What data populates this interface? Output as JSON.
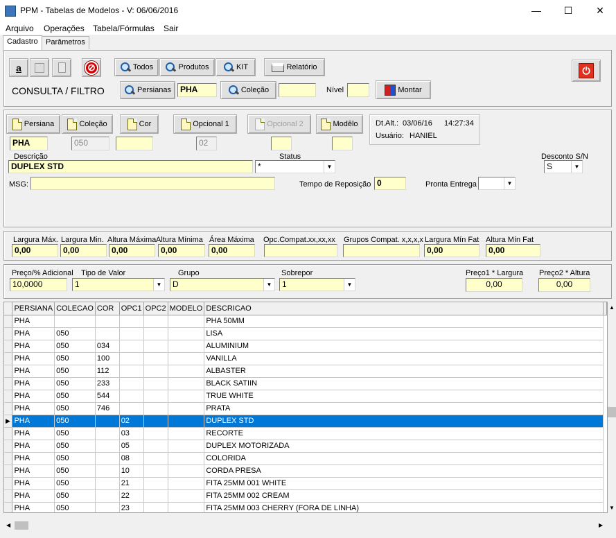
{
  "window": {
    "title": "PPM - Tabelas de Modelos - V: 06/06/2016",
    "minimize": "—",
    "maximize": "☐",
    "close": "✕"
  },
  "menu": [
    "Arquivo",
    "Operações",
    "Tabela/Fórmulas",
    "Sair"
  ],
  "tabs": [
    "Cadastro",
    "Parâmetros"
  ],
  "toolbar": {
    "todos": "Todos",
    "produtos": "Produtos",
    "kit": "KIT",
    "relatorio": "Relatório",
    "persianas": "Persianas",
    "colecao": "Coleção",
    "montar": "Montar",
    "consulta_label": "CONSULTA / FILTRO",
    "nivel_label": "Nível",
    "persiana_filter": "PHA",
    "colecao_filter": "",
    "nivel_value": ""
  },
  "record": {
    "persiana_btn": "Persiana",
    "colecao_btn": "Coleção",
    "cor_btn": "Cor",
    "opc1_btn": "Opcional 1",
    "opc2_btn": "Opcional 2",
    "modelo_btn": "Modêlo",
    "persiana": "PHA",
    "colecao": "050",
    "cor": "",
    "opc1": "02",
    "opc2": "",
    "modelo": "",
    "dt_alt_label": "Dt.Alt.:",
    "dt_alt_date": "03/06/16",
    "dt_alt_time": "14:27:34",
    "usuario_label": "Usuário:",
    "usuario": "HANIEL",
    "descricao_label": "Descrição",
    "descricao": "DUPLEX STD",
    "status_label": "Status",
    "status": "*",
    "desconto_label": "Desconto S/N",
    "desconto": "S",
    "msg_label": "MSG:",
    "msg": "",
    "tempo_label": "Tempo de Reposição",
    "tempo": "0",
    "pronta_label": "Pronta Entrega",
    "pronta": ""
  },
  "dims": {
    "larg_max_label": "Largura Máx.",
    "larg_max": "0,00",
    "larg_min_label": "Largura Min.",
    "larg_min": "0,00",
    "alt_max_label": "Altura Máxima",
    "alt_max": "0,00",
    "alt_min_label": "Altura Mínima",
    "alt_min": "0,00",
    "area_label": "Área Máxima",
    "area": "0,00",
    "opc_compat_label": "Opc.Compat.xx,xx,xx",
    "opc_compat": "",
    "grupos_label": "Grupos Compat. x,x,x,x",
    "grupos": "",
    "larg_fat_label": "Largura Mín Fat",
    "larg_fat": "0,00",
    "alt_fat_label": "Altura Mín Fat",
    "alt_fat": "0,00"
  },
  "price": {
    "preco_label": "Preço/% Adicional",
    "preco": "10,0000",
    "tipo_label": "Tipo de Valor",
    "tipo": "1",
    "grupo_label": "Grupo",
    "grupo": "D",
    "sobrepor_label": "Sobrepor",
    "sobrepor": "1",
    "p1_label": "Preço1 * Largura",
    "p1": "0,00",
    "p2_label": "Preço2 * Altura",
    "p2": "0,00"
  },
  "grid": {
    "columns": [
      "PERSIANA",
      "COLECAO",
      "COR",
      "OPC1",
      "OPC2",
      "MODELO",
      "DESCRICAO"
    ],
    "rows": [
      [
        "PHA",
        "",
        "",
        "",
        "",
        "",
        "PHA 50MM"
      ],
      [
        "PHA",
        "050",
        "",
        "",
        "",
        "",
        "LISA"
      ],
      [
        "PHA",
        "050",
        "034",
        "",
        "",
        "",
        "ALUMINIUM"
      ],
      [
        "PHA",
        "050",
        "100",
        "",
        "",
        "",
        "VANILLA"
      ],
      [
        "PHA",
        "050",
        "112",
        "",
        "",
        "",
        "ALBASTER"
      ],
      [
        "PHA",
        "050",
        "233",
        "",
        "",
        "",
        "BLACK SATIIN"
      ],
      [
        "PHA",
        "050",
        "544",
        "",
        "",
        "",
        "TRUE WHITE"
      ],
      [
        "PHA",
        "050",
        "746",
        "",
        "",
        "",
        "PRATA"
      ],
      [
        "PHA",
        "050",
        "",
        "02",
        "",
        "",
        "DUPLEX STD"
      ],
      [
        "PHA",
        "050",
        "",
        "03",
        "",
        "",
        "RECORTE"
      ],
      [
        "PHA",
        "050",
        "",
        "05",
        "",
        "",
        "DUPLEX MOTORIZADA"
      ],
      [
        "PHA",
        "050",
        "",
        "08",
        "",
        "",
        "COLORIDA"
      ],
      [
        "PHA",
        "050",
        "",
        "10",
        "",
        "",
        "CORDA PRESA"
      ],
      [
        "PHA",
        "050",
        "",
        "21",
        "",
        "",
        "FITA 25MM 001 WHITE"
      ],
      [
        "PHA",
        "050",
        "",
        "22",
        "",
        "",
        "FITA 25MM 002 CREAM"
      ],
      [
        "PHA",
        "050",
        "",
        "23",
        "",
        "",
        "FITA 25MM 003 CHERRY (FORA DE LINHA)"
      ]
    ],
    "selected_row": 8
  }
}
